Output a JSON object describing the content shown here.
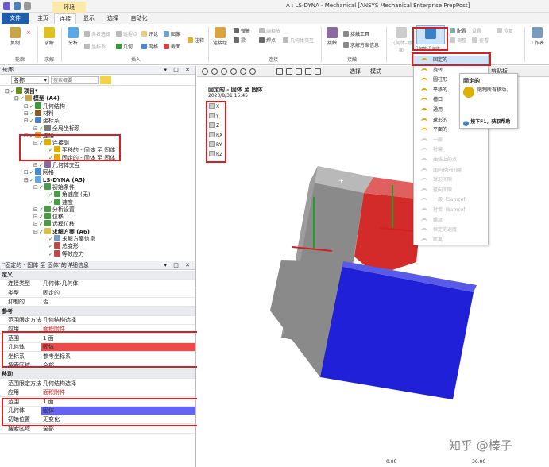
{
  "window": {
    "title": "A : LS-DYNA - Mechanical [ANSYS Mechanical Enterprise PrepPost]",
    "context_tab": "环境"
  },
  "tabs": [
    "文件",
    "主页",
    "连接",
    "显示",
    "选择",
    "自动化"
  ],
  "ribbon": {
    "groups": [
      {
        "label": "轮廓",
        "buttons": [
          "复制",
          "✕"
        ]
      },
      {
        "label": "求解",
        "buttons": [
          "求解"
        ]
      },
      {
        "label": "插入",
        "buttons": [
          "分析",
          "命名选择",
          "远程点",
          "评论",
          "图像",
          "坐标系",
          "几何",
          "网格",
          "截面"
        ]
      },
      {
        "label": "",
        "buttons": [
          "注释"
        ]
      },
      {
        "label": "连接",
        "buttons": [
          "连接组",
          "弹簧",
          "梁",
          "端释放",
          "焊点",
          "几何体交互"
        ]
      },
      {
        "label": "接触",
        "buttons": [
          "接触",
          "接触工具",
          "求解方案信息"
        ]
      },
      {
        "label": "",
        "buttons": [
          "几何体-地面",
          "几何体-几何体",
          "配置",
          "调整",
          "设置",
          "查看",
          "恢复"
        ]
      },
      {
        "label": "",
        "buttons": [
          "工作表"
        ]
      }
    ]
  },
  "outline": {
    "header": "轮廓",
    "filter": {
      "label": "名称",
      "placeholder": "搜索概要"
    },
    "tree": [
      {
        "text": "项目*",
        "level": 0,
        "bold": true
      },
      {
        "text": "模型 (A4)",
        "level": 1,
        "bold": true
      },
      {
        "text": "几何结构",
        "level": 2
      },
      {
        "text": "材料",
        "level": 2
      },
      {
        "text": "坐标系",
        "level": 2
      },
      {
        "text": "全局坐标系",
        "level": 3
      },
      {
        "text": "连接",
        "level": 2
      },
      {
        "text": "连接副",
        "level": 3
      },
      {
        "text": "平移的 - 固体 至 固体",
        "level": 4
      },
      {
        "text": "固定的 - 固体 至 固体",
        "level": 4
      },
      {
        "text": "几何体交互",
        "level": 3
      },
      {
        "text": "网格",
        "level": 2
      },
      {
        "text": "LS-DYNA (A5)",
        "level": 2,
        "bold": true
      },
      {
        "text": "初始条件",
        "level": 3
      },
      {
        "text": "角速度 (无)",
        "level": 4
      },
      {
        "text": "速度",
        "level": 4
      },
      {
        "text": "分析设置",
        "level": 3
      },
      {
        "text": "位移",
        "level": 3
      },
      {
        "text": "远程位移",
        "level": 3
      },
      {
        "text": "求解方案 (A6)",
        "level": 3,
        "bold": true
      },
      {
        "text": "求解方案信息",
        "level": 4
      },
      {
        "text": "总变形",
        "level": 4
      },
      {
        "text": "等效应力",
        "level": 4
      }
    ]
  },
  "details": {
    "header": "\"固定的 - 固体 至 固体\"的详细信息",
    "rows": [
      {
        "type": "section",
        "k": "定义"
      },
      {
        "k": "连接类型",
        "v": "几何体-几何体"
      },
      {
        "k": "类型",
        "v": "固定的"
      },
      {
        "k": "抑制的",
        "v": "否"
      },
      {
        "type": "section",
        "k": "参考"
      },
      {
        "k": "范围限定方法",
        "v": "几何结构选择"
      },
      {
        "k": "应用",
        "v": "面积附件",
        "dim": true
      },
      {
        "k": "范围",
        "v": "1 面"
      },
      {
        "k": "几何体",
        "v": "固体",
        "hl": "#ef4a4a"
      },
      {
        "k": "坐标系",
        "v": "参考坐标系"
      },
      {
        "k": "搜索区域",
        "v": "全部"
      },
      {
        "type": "section",
        "k": "移动"
      },
      {
        "k": "范围限定方法",
        "v": "几何结构选择"
      },
      {
        "k": "应用",
        "v": "面积附件",
        "dim": true
      },
      {
        "k": "范围",
        "v": "1 面"
      },
      {
        "k": "几何体",
        "v": "固体",
        "hl": "#6464f0"
      },
      {
        "k": "初始位置",
        "v": "无变化"
      },
      {
        "k": "搜索区域",
        "v": "全部"
      }
    ]
  },
  "viewport": {
    "toolbar_labels": [
      "选择",
      "模式",
      "剪贴板"
    ],
    "item_title": "固定的 - 固体 至 固体",
    "date": "2023/8/31 15:45",
    "dof": [
      "X",
      "Y",
      "Z",
      "RX",
      "RY",
      "RZ"
    ],
    "colors": {
      "red_body": "#d32a2a",
      "blue_body": "#2020d8",
      "gray_body": "#8a8a8a"
    },
    "scale": [
      "0.00",
      "30.00"
    ]
  },
  "joint_menu": {
    "items": [
      {
        "label": "固定的",
        "enabled": true,
        "selected": true
      },
      {
        "label": "旋转",
        "enabled": true
      },
      {
        "label": "圆柱形",
        "enabled": true
      },
      {
        "label": "平移的",
        "enabled": true
      },
      {
        "label": "槽口",
        "enabled": true
      },
      {
        "label": "通用",
        "enabled": true
      },
      {
        "label": "球形的",
        "enabled": true
      },
      {
        "label": "平面的",
        "enabled": true
      },
      {
        "label": "一般",
        "enabled": false
      },
      {
        "label": "衬套",
        "enabled": false
      },
      {
        "label": "曲线上的点",
        "enabled": false
      },
      {
        "label": "面内径向间隙",
        "enabled": false
      },
      {
        "label": "球形间隙",
        "enabled": false
      },
      {
        "label": "径向间隙",
        "enabled": false
      },
      {
        "label": "一般（Samcef)",
        "enabled": false
      },
      {
        "label": "衬套（Samcef)",
        "enabled": false
      },
      {
        "label": "螺丝",
        "enabled": false
      },
      {
        "label": "恒定的速度",
        "enabled": false
      },
      {
        "label": "距离",
        "enabled": false
      }
    ]
  },
  "tooltip": {
    "title": "固定的",
    "body": "限制所有移动。",
    "help": "按下F1，获取帮助"
  },
  "watermark": "知乎 @榛子"
}
